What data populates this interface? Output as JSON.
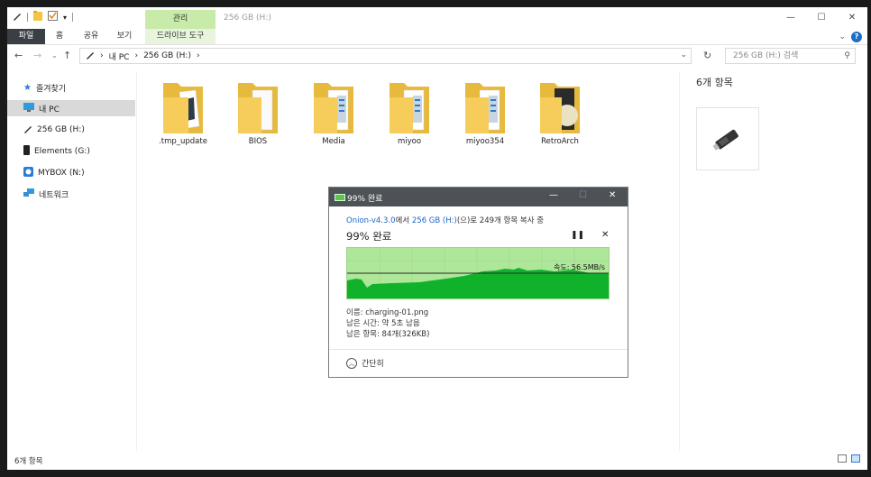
{
  "window": {
    "title": "256 GB (H:)",
    "contextual_tab_group": "관리",
    "controls": {
      "minimize": "—",
      "maximize": "☐",
      "close": "✕"
    }
  },
  "ribbon": {
    "tabs": [
      {
        "label": "파일"
      },
      {
        "label": "홈"
      },
      {
        "label": "공유"
      },
      {
        "label": "보기"
      },
      {
        "label": "드라이브 도구"
      }
    ],
    "help_label": "?"
  },
  "address": {
    "path": [
      "내 PC",
      "256 GB (H:)"
    ],
    "search_placeholder": "256 GB (H:) 검색"
  },
  "sidebar": {
    "items": [
      {
        "label": "즐겨찾기",
        "icon": "star-icon"
      },
      {
        "label": "내 PC",
        "icon": "computer-icon",
        "selected": true
      },
      {
        "label": "256 GB (H:)",
        "icon": "usb-drive-icon"
      },
      {
        "label": "Elements (G:)",
        "icon": "external-drive-icon"
      },
      {
        "label": "MYBOX (N:)",
        "icon": "cloud-drive-icon"
      },
      {
        "label": "네트워크",
        "icon": "network-icon"
      }
    ]
  },
  "folders": [
    {
      "name": ".tmp_update"
    },
    {
      "name": "BIOS"
    },
    {
      "name": "Media"
    },
    {
      "name": "miyoo"
    },
    {
      "name": "miyoo354"
    },
    {
      "name": "RetroArch"
    }
  ],
  "details": {
    "title": "6개 항목",
    "icon": "usb-drive-icon"
  },
  "status_bar": {
    "item_count": "6개 항목"
  },
  "copy_dialog": {
    "title": "99% 완료",
    "source": "Onion-v4.3.0",
    "source_mid": "에서 ",
    "dest": "256 GB (H:)",
    "dest_tail": "(으)로 249개 항목 복사 중",
    "percent_text": "99% 완료",
    "progress": 0.99,
    "speed": "속도: 56.5MB/s",
    "name_line": "이름: charging-01.png",
    "time_line": "남은 시간: 약 5초 남음",
    "items_line": "남은 항목: 84개(326KB)",
    "fewer_details": "간단히",
    "colors": {
      "graph_bg": "#aee79a",
      "graph_fill": "#11b22b",
      "title_bg": "#4d5257"
    }
  }
}
